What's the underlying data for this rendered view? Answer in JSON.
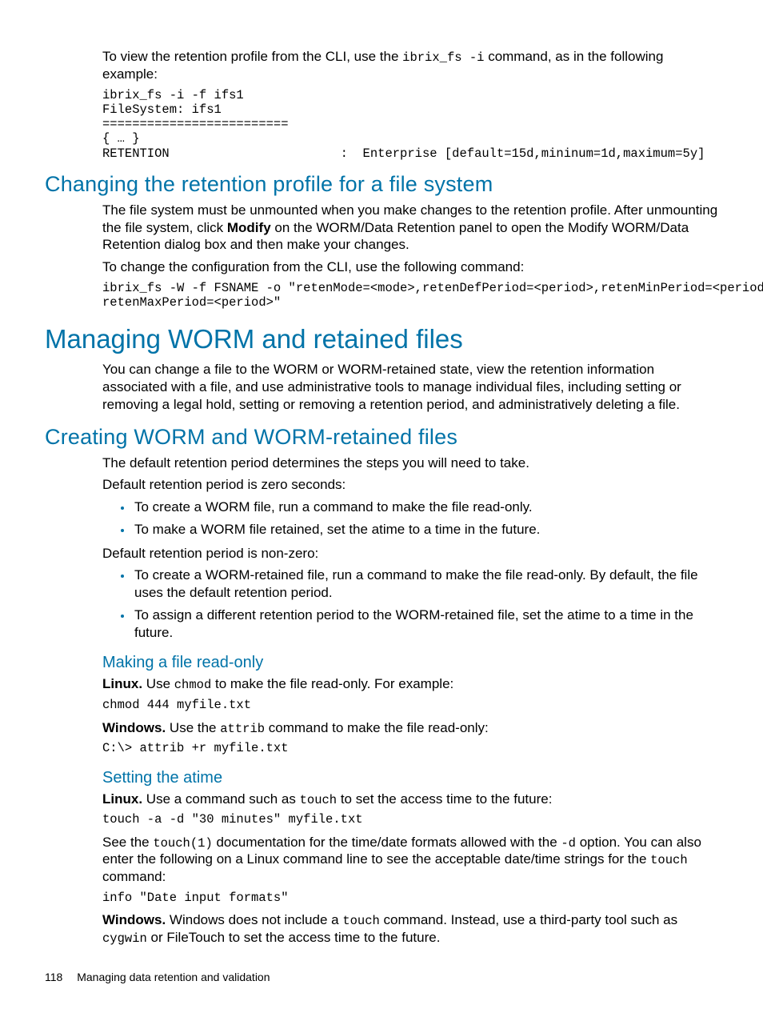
{
  "intro": {
    "p1a": "To view the retention profile from the CLI, use the ",
    "p1code": "ibrix_fs -i",
    "p1b": " command, as in the following example:",
    "code1": "ibrix_fs -i -f ifs1\nFileSystem: ifs1\n=========================\n{ … }\nRETENTION                       :  Enterprise [default=15d,mininum=1d,maximum=5y]"
  },
  "sec_change": {
    "title": "Changing the retention profile for a file system",
    "p1a": "The file system must be unmounted when you make changes to the retention profile. After unmounting the file system, click ",
    "p1b": "Modify",
    "p1c": " on the WORM/Data Retention panel to open the Modify WORM/Data Retention dialog box and then make your changes.",
    "p2": "To change the configuration from the CLI, use the following command:",
    "code": "ibrix_fs -W -f FSNAME -o \"retenMode=<mode>,retenDefPeriod=<period>,retenMinPeriod=<period>,\nretenMaxPeriod=<period>\""
  },
  "sec_manage": {
    "title": "Managing WORM and retained files",
    "p1": "You can change a file to the WORM or WORM-retained state, view the retention information associated with a file, and use administrative tools to manage individual files, including setting or removing a legal hold, setting or removing a retention period, and administratively deleting a file."
  },
  "sec_create": {
    "title": "Creating WORM and WORM-retained files",
    "p1": "The default retention period determines the steps you will need to take.",
    "h_zero": "Default retention period is zero seconds:",
    "zero_items": [
      "To create a WORM file, run a command to make the file read-only.",
      "To make a WORM file retained, set the atime to a time in the future."
    ],
    "h_nonzero": "Default retention period is non-zero:",
    "nonzero_items": [
      "To create a WORM-retained file, run a command to make the file read-only. By default, the file uses the default retention period.",
      "To assign a different retention period to the WORM-retained file, set the atime to a time in the future."
    ]
  },
  "sub_readonly": {
    "title": "Making a file read-only",
    "linux_lbl": "Linux.",
    "linux_a": " Use ",
    "linux_code": "chmod",
    "linux_b": " to make the file read-only. For example:",
    "linux_cmd": "chmod 444 myfile.txt",
    "win_lbl": "Windows.",
    "win_a": "  Use the ",
    "win_code": "attrib",
    "win_b": " command to make the file read-only:",
    "win_cmd": "C:\\> attrib +r myfile.txt"
  },
  "sub_atime": {
    "title": "Setting the atime",
    "linux_lbl": "Linux.",
    "linux_a": " Use a command such as ",
    "linux_code": "touch",
    "linux_b": " to set the access time to the future:",
    "linux_cmd": "touch -a -d \"30 minutes\" myfile.txt",
    "see_a": "See the ",
    "see_code1": "touch(1)",
    "see_b": " documentation for the time/date formats allowed with the ",
    "see_code2": "-d",
    "see_c": " option. You can also enter the following on a Linux command line to see the acceptable date/time strings for the ",
    "see_code3": "touch",
    "see_d": " command:",
    "info_cmd": "info \"Date input formats\"",
    "win_lbl": "Windows.",
    "win_a": " Windows does not include a ",
    "win_code1": "touch",
    "win_b": " command. Instead, use a third-party tool such as ",
    "win_code2": "cygwin",
    "win_c": " or FileTouch to set the access time to the future."
  },
  "footer": {
    "page_number": "118",
    "section": "Managing data retention and validation"
  }
}
